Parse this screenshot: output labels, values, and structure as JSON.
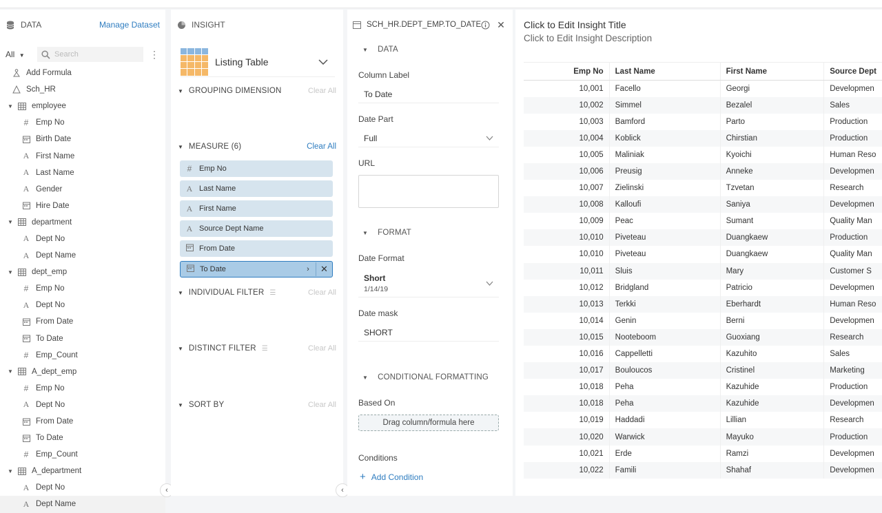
{
  "data_panel": {
    "title": "DATA",
    "manage_link": "Manage Dataset",
    "filter_select": "All",
    "search_placeholder": "Search",
    "add_formula": "Add Formula",
    "tree": [
      {
        "label": "Sch_HR",
        "icon": "schema-icon",
        "level": 0,
        "caret": ""
      },
      {
        "label": "employee",
        "icon": "table-icon",
        "level": 1,
        "caret": "▼"
      },
      {
        "label": "Emp No",
        "icon": "number-icon",
        "level": 2
      },
      {
        "label": "Birth Date",
        "icon": "calendar-icon",
        "level": 2
      },
      {
        "label": "First Name",
        "icon": "text-icon",
        "level": 2
      },
      {
        "label": "Last Name",
        "icon": "text-icon",
        "level": 2
      },
      {
        "label": "Gender",
        "icon": "text-icon",
        "level": 2
      },
      {
        "label": "Hire Date",
        "icon": "calendar-icon",
        "level": 2
      },
      {
        "label": "department",
        "icon": "table-icon",
        "level": 1,
        "caret": "▼"
      },
      {
        "label": "Dept No",
        "icon": "text-icon",
        "level": 2
      },
      {
        "label": "Dept Name",
        "icon": "text-icon",
        "level": 2
      },
      {
        "label": "dept_emp",
        "icon": "table-icon",
        "level": 1,
        "caret": "▼"
      },
      {
        "label": "Emp No",
        "icon": "number-icon",
        "level": 2
      },
      {
        "label": "Dept No",
        "icon": "text-icon",
        "level": 2
      },
      {
        "label": "From Date",
        "icon": "calendar-icon",
        "level": 2
      },
      {
        "label": "To Date",
        "icon": "calendar-icon",
        "level": 2
      },
      {
        "label": "Emp_Count",
        "icon": "number-icon",
        "level": 2
      },
      {
        "label": "A_dept_emp",
        "icon": "table-icon",
        "level": 1,
        "caret": "▼"
      },
      {
        "label": "Emp No",
        "icon": "number-icon",
        "level": 2
      },
      {
        "label": "Dept No",
        "icon": "text-icon",
        "level": 2
      },
      {
        "label": "From Date",
        "icon": "calendar-icon",
        "level": 2
      },
      {
        "label": "To Date",
        "icon": "calendar-icon",
        "level": 2
      },
      {
        "label": "Emp_Count",
        "icon": "number-icon",
        "level": 2
      },
      {
        "label": "A_department",
        "icon": "table-icon",
        "level": 1,
        "caret": "▼"
      },
      {
        "label": "Dept No",
        "icon": "text-icon",
        "level": 2
      },
      {
        "label": "Dept Name",
        "icon": "text-icon",
        "level": 2,
        "selected": true
      }
    ]
  },
  "insight_panel": {
    "title": "INSIGHT",
    "chart_type": "Listing Table",
    "grouping": {
      "title": "GROUPING DIMENSION",
      "clear": "Clear All"
    },
    "measure": {
      "title": "MEASURE (6)",
      "clear": "Clear All"
    },
    "measures": [
      {
        "label": "Emp No",
        "icon": "number-icon"
      },
      {
        "label": "Last Name",
        "icon": "text-icon"
      },
      {
        "label": "First Name",
        "icon": "text-icon"
      },
      {
        "label": "Source Dept Name",
        "icon": "text-icon"
      },
      {
        "label": "From Date",
        "icon": "calendar-icon"
      },
      {
        "label": "To Date",
        "icon": "calendar-icon",
        "active": true
      }
    ],
    "individual_filter": {
      "title": "INDIVIDUAL FILTER",
      "clear": "Clear All"
    },
    "distinct_filter": {
      "title": "DISTINCT FILTER",
      "clear": "Clear All"
    },
    "sort_by": {
      "title": "SORT BY",
      "clear": "Clear All"
    }
  },
  "props_panel": {
    "title": "SCH_HR.DEPT_EMP.TO_DATE",
    "data_section": "DATA",
    "column_label": {
      "label": "Column Label",
      "value": "To Date"
    },
    "date_part": {
      "label": "Date Part",
      "value": "Full"
    },
    "url": {
      "label": "URL"
    },
    "format_section": "FORMAT",
    "date_format": {
      "label": "Date Format",
      "value": "Short",
      "example": "1/14/19"
    },
    "date_mask": {
      "label": "Date mask",
      "value": "SHORT"
    },
    "cond_section": "CONDITIONAL FORMATTING",
    "based_on": {
      "label": "Based On",
      "dropzone": "Drag column/formula here"
    },
    "conditions": {
      "label": "Conditions",
      "add": "Add Condition"
    }
  },
  "content": {
    "title": "Click to Edit Insight Title",
    "description": "Click to Edit Insight Description",
    "columns": [
      "Emp No",
      "Last Name",
      "First Name",
      "Source Dept"
    ],
    "rows": [
      [
        "10,001",
        "Facello",
        "Georgi",
        "Developmen"
      ],
      [
        "10,002",
        "Simmel",
        "Bezalel",
        "Sales"
      ],
      [
        "10,003",
        "Bamford",
        "Parto",
        "Production"
      ],
      [
        "10,004",
        "Koblick",
        "Chirstian",
        "Production"
      ],
      [
        "10,005",
        "Maliniak",
        "Kyoichi",
        "Human Reso"
      ],
      [
        "10,006",
        "Preusig",
        "Anneke",
        "Developmen"
      ],
      [
        "10,007",
        "Zielinski",
        "Tzvetan",
        "Research"
      ],
      [
        "10,008",
        "Kalloufi",
        "Saniya",
        "Developmen"
      ],
      [
        "10,009",
        "Peac",
        "Sumant",
        "Quality Man"
      ],
      [
        "10,010",
        "Piveteau",
        "Duangkaew",
        "Production"
      ],
      [
        "10,010",
        "Piveteau",
        "Duangkaew",
        "Quality Man"
      ],
      [
        "10,011",
        "Sluis",
        "Mary",
        "Customer S"
      ],
      [
        "10,012",
        "Bridgland",
        "Patricio",
        "Developmen"
      ],
      [
        "10,013",
        "Terkki",
        "Eberhardt",
        "Human Reso"
      ],
      [
        "10,014",
        "Genin",
        "Berni",
        "Developmen"
      ],
      [
        "10,015",
        "Nooteboom",
        "Guoxiang",
        "Research"
      ],
      [
        "10,016",
        "Cappelletti",
        "Kazuhito",
        "Sales"
      ],
      [
        "10,017",
        "Bouloucos",
        "Cristinel",
        "Marketing"
      ],
      [
        "10,018",
        "Peha",
        "Kazuhide",
        "Production"
      ],
      [
        "10,018",
        "Peha",
        "Kazuhide",
        "Developmen"
      ],
      [
        "10,019",
        "Haddadi",
        "Lillian",
        "Research"
      ],
      [
        "10,020",
        "Warwick",
        "Mayuko",
        "Production"
      ],
      [
        "10,021",
        "Erde",
        "Ramzi",
        "Developmen"
      ],
      [
        "10,022",
        "Famili",
        "Shahaf",
        "Developmen"
      ]
    ]
  }
}
